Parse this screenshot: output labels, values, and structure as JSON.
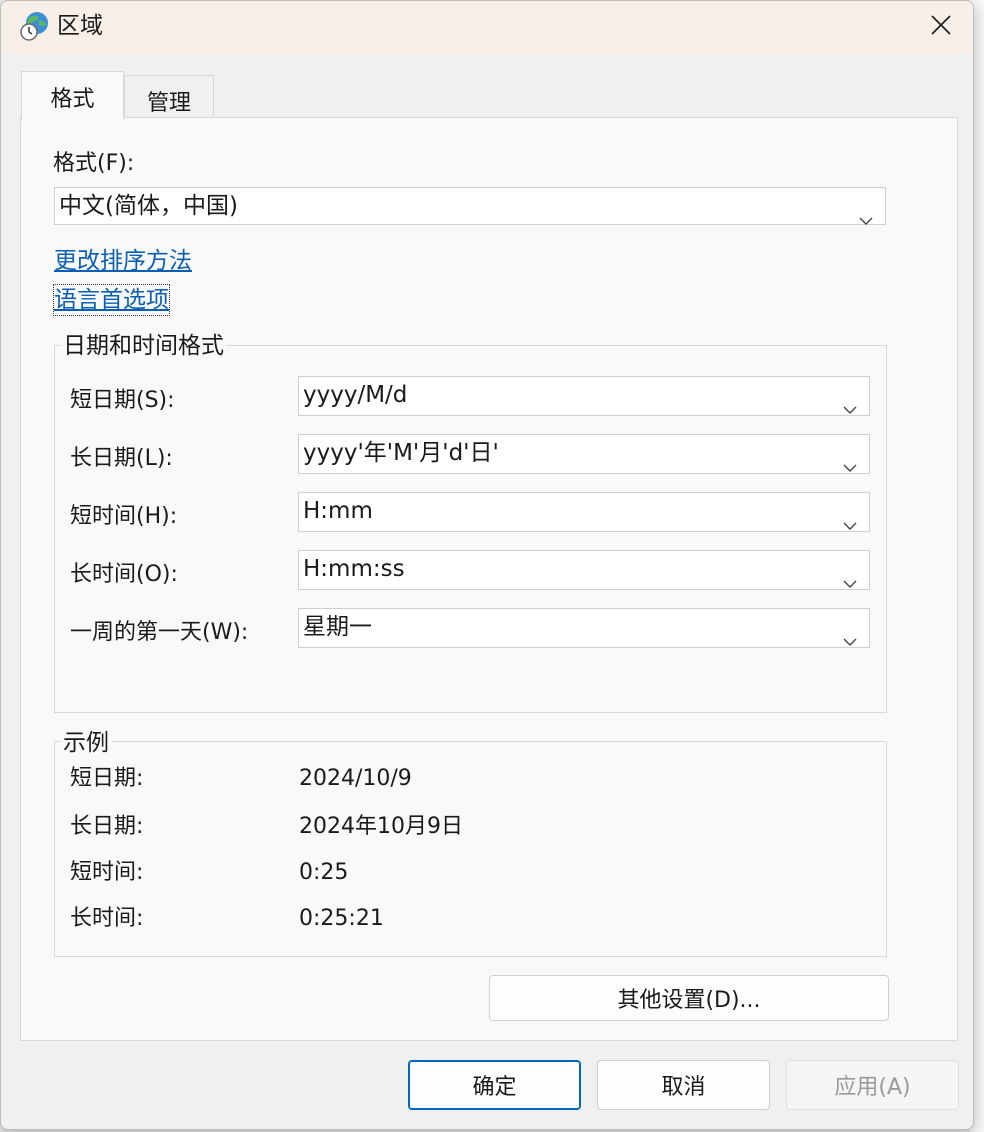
{
  "window": {
    "title": "区域"
  },
  "tabs": [
    {
      "label": "格式",
      "active": true
    },
    {
      "label": "管理",
      "active": false
    }
  ],
  "format": {
    "label": "格式(F):",
    "value": "中文(简体，中国)"
  },
  "links": {
    "change_sort": "更改排序方法",
    "language_prefs": "语言首选项"
  },
  "datetime_group": {
    "title": "日期和时间格式",
    "rows": [
      {
        "label": "短日期(S):",
        "value": "yyyy/M/d"
      },
      {
        "label": "长日期(L):",
        "value": "yyyy'年'M'月'd'日'"
      },
      {
        "label": "短时间(H):",
        "value": "H:mm"
      },
      {
        "label": "长时间(O):",
        "value": "H:mm:ss"
      },
      {
        "label": "一周的第一天(W):",
        "value": "星期一"
      }
    ]
  },
  "examples_group": {
    "title": "示例",
    "rows": [
      {
        "label": "短日期:",
        "value": "2024/10/9"
      },
      {
        "label": "长日期:",
        "value": "2024年10月9日"
      },
      {
        "label": "短时间:",
        "value": "0:25"
      },
      {
        "label": "长时间:",
        "value": "0:25:21"
      }
    ]
  },
  "buttons": {
    "other_settings": "其他设置(D)...",
    "ok": "确定",
    "cancel": "取消",
    "apply": "应用(A)"
  },
  "icons": {
    "title": "globe-clock-icon",
    "close": "close-icon",
    "dropdown": "chevron-down-icon"
  },
  "colors": {
    "link": "#0a5fb5",
    "titlebar": "#f7efe8",
    "primary_border": "#0067c0"
  }
}
